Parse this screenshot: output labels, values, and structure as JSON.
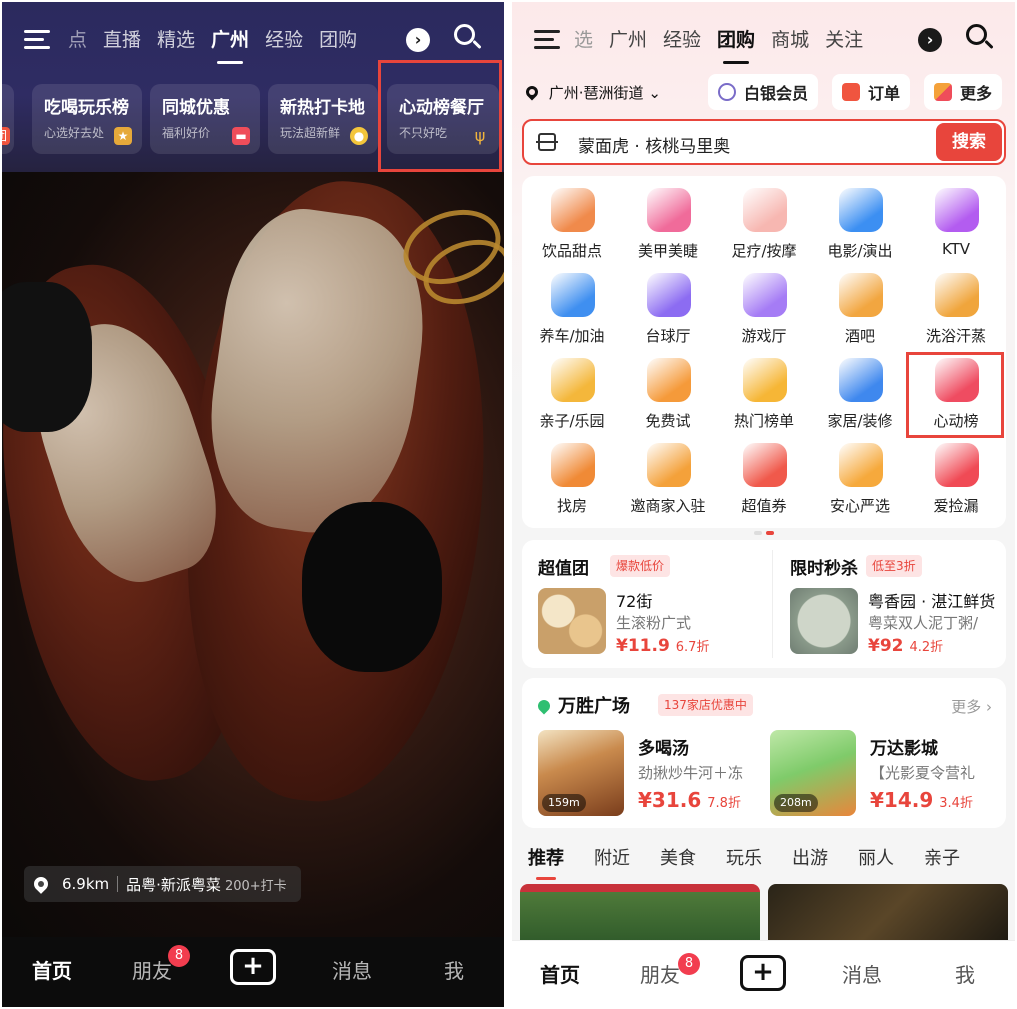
{
  "left": {
    "tabs": [
      "点",
      "直播",
      "精选",
      "广州",
      "经验",
      "团购"
    ],
    "active_tab": "广州",
    "cards": [
      {
        "title": "吃喝玩乐榜",
        "subtitle": "心选好去处"
      },
      {
        "title": "同城优惠",
        "subtitle": "福利好价"
      },
      {
        "title": "新热打卡地",
        "subtitle": "玩法超新鲜"
      },
      {
        "title": "心动榜餐厅",
        "subtitle": "不只好吃"
      }
    ],
    "edge_card_char": "团",
    "location": {
      "distance": "6.9km",
      "name": "品粤·新派粤菜",
      "checkins": "200+打卡"
    },
    "bottom_nav": {
      "home": "首页",
      "friends": "朋友",
      "friends_badge": "8",
      "add": "+",
      "messages": "消息",
      "me": "我"
    }
  },
  "right": {
    "tabs": [
      "选",
      "广州",
      "经验",
      "团购",
      "商城",
      "关注"
    ],
    "active_tab": "团购",
    "location": "广州·琶洲街道",
    "chips": {
      "member": "白银会员",
      "orders": "订单",
      "more": "更多"
    },
    "search": {
      "text": "蒙面虎 · 核桃马里奥",
      "button": "搜索"
    },
    "categories": [
      {
        "label": "饮品甜点",
        "icon": "drink-icon",
        "color": "#f08a4b"
      },
      {
        "label": "美甲美睫",
        "icon": "nail-polish-icon",
        "color": "#f06b9a"
      },
      {
        "label": "足疗/按摩",
        "icon": "hands-icon",
        "color": "#f7b7b1"
      },
      {
        "label": "电影/演出",
        "icon": "film-reel-icon",
        "color": "#3c8ff2"
      },
      {
        "label": "KTV",
        "icon": "microphone-icon",
        "color": "#b35cf0"
      },
      {
        "label": "养车/加油",
        "icon": "car-icon",
        "color": "#3f8ff0"
      },
      {
        "label": "台球厅",
        "icon": "billiard-ball-icon",
        "color": "#8c6cf2"
      },
      {
        "label": "游戏厅",
        "icon": "gamepad-icon",
        "color": "#a57cf5"
      },
      {
        "label": "酒吧",
        "icon": "beer-icon",
        "color": "#f2a640"
      },
      {
        "label": "洗浴汗蒸",
        "icon": "bath-icon",
        "color": "#f0a53c"
      },
      {
        "label": "亲子/乐园",
        "icon": "rocking-horse-icon",
        "color": "#f4b73b"
      },
      {
        "label": "免费试",
        "icon": "free-coin-icon",
        "color": "#f59a3a"
      },
      {
        "label": "热门榜单",
        "icon": "trophy-icon",
        "color": "#f6b636"
      },
      {
        "label": "家居/装修",
        "icon": "paint-roller-icon",
        "color": "#3f88ee"
      },
      {
        "label": "心动榜",
        "icon": "heartbeat-icon",
        "color": "#ef4c61"
      },
      {
        "label": "找房",
        "icon": "house-icon",
        "color": "#f08a36"
      },
      {
        "label": "邀商家入驻",
        "icon": "shop-icon",
        "color": "#f4a13a"
      },
      {
        "label": "超值券",
        "icon": "coupon-icon",
        "color": "#f0594b"
      },
      {
        "label": "安心严选",
        "icon": "shield-heart-icon",
        "color": "#f6a93c"
      },
      {
        "label": "爱捡漏",
        "icon": "pick-badge-icon",
        "color": "#f04a55"
      }
    ],
    "deals": [
      {
        "header": "超值团",
        "tag": "爆款低价",
        "name": "72街",
        "desc": "生滚粉广式",
        "price": "¥11.9",
        "discount": "6.7折"
      },
      {
        "header": "限时秒杀",
        "tag": "低至3折",
        "name": "粤香园 · 湛江鲜货",
        "desc": "粤菜双人泥丁粥/",
        "price": "¥92",
        "discount": "4.2折"
      }
    ],
    "plaza": {
      "name": "万胜广场",
      "tag": "137家店优惠中",
      "more": "更多",
      "shops": [
        {
          "name": "多喝汤",
          "desc": "劲揪炒牛河＋冻",
          "price": "¥31.6",
          "discount": "7.8折",
          "distance": "159m"
        },
        {
          "name": "万达影城",
          "desc": "【光影夏令营礼",
          "price": "¥14.9",
          "discount": "3.4折",
          "distance": "208m"
        }
      ]
    },
    "feed_tabs": [
      "推荐",
      "附近",
      "美食",
      "玩乐",
      "出游",
      "丽人",
      "亲子"
    ],
    "bottom_nav": {
      "home": "首页",
      "friends": "朋友",
      "friends_badge": "8",
      "add": "+",
      "messages": "消息",
      "me": "我"
    }
  },
  "colors": {
    "accent": "#e8453c",
    "highlight_box": "#e8453c",
    "badge": "#f23d4f"
  }
}
